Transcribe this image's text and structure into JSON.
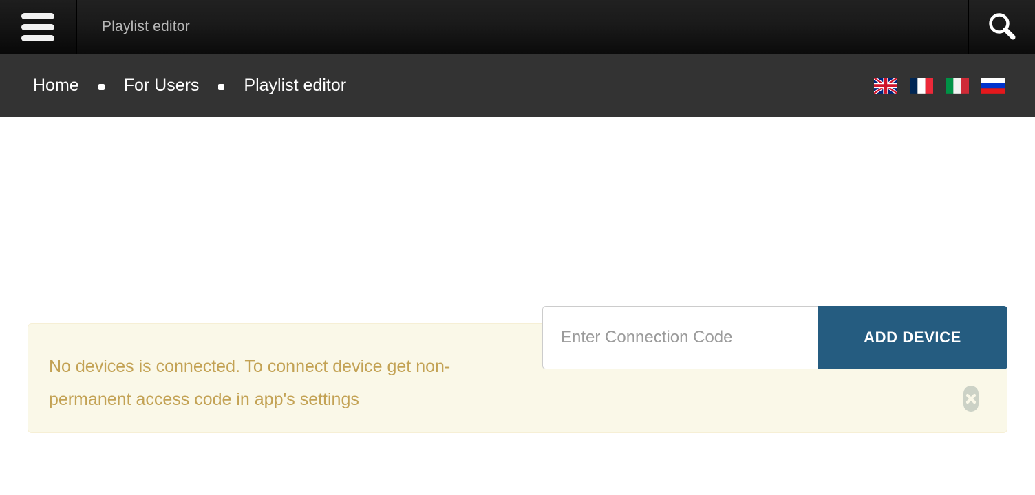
{
  "topbar": {
    "menu_icon": "hamburger-menu-icon",
    "title": "Playlist editor",
    "search_icon": "search-icon"
  },
  "breadcrumb": {
    "items": [
      {
        "label": "Home"
      },
      {
        "label": "For Users"
      },
      {
        "label": "Playlist editor"
      }
    ],
    "separator_icon": "dot-separator-icon"
  },
  "languages": [
    {
      "name": "English",
      "code": "en",
      "icon": "flag-uk-icon"
    },
    {
      "name": "French",
      "code": "fr",
      "icon": "flag-france-icon"
    },
    {
      "name": "Italian",
      "code": "it",
      "icon": "flag-italy-icon"
    },
    {
      "name": "Russian",
      "code": "ru",
      "icon": "flag-russia-icon"
    }
  ],
  "alert": {
    "message": "No devices is connected. To connect device get non-permanent access code in app's settings",
    "close_icon": "close-x-icon",
    "background_color": "#faf8e8",
    "text_color": "#c3a254"
  },
  "device_form": {
    "input_placeholder": "Enter Connection Code",
    "input_value": "",
    "button_label": "ADD DEVICE",
    "button_color": "#255c80"
  }
}
